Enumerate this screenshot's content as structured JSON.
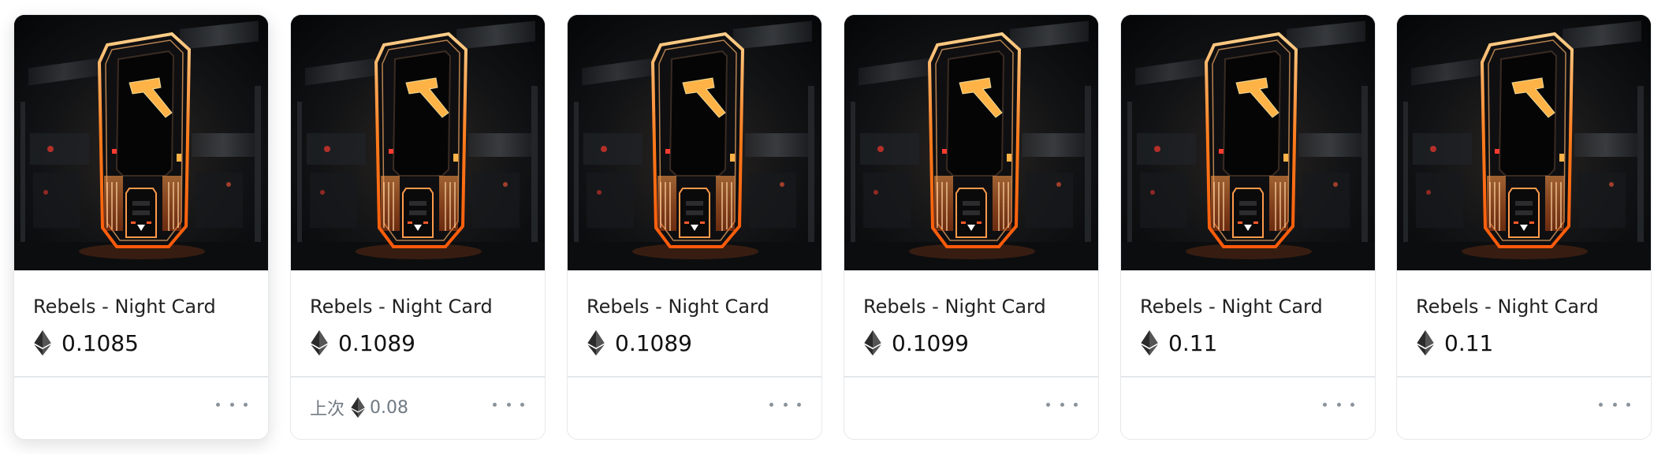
{
  "cards": [
    {
      "title": "Rebels - Night Card",
      "price": "0.1085",
      "last_label": "",
      "last_price": "",
      "currency_icon": "ethereum-icon"
    },
    {
      "title": "Rebels - Night Card",
      "price": "0.1089",
      "last_label": "上次",
      "last_price": "0.08",
      "currency_icon": "ethereum-icon"
    },
    {
      "title": "Rebels - Night Card",
      "price": "0.1089",
      "last_label": "",
      "last_price": "",
      "currency_icon": "ethereum-icon"
    },
    {
      "title": "Rebels - Night Card",
      "price": "0.1099",
      "last_label": "",
      "last_price": "",
      "currency_icon": "ethereum-icon"
    },
    {
      "title": "Rebels - Night Card",
      "price": "0.11",
      "last_label": "",
      "last_price": "",
      "currency_icon": "ethereum-icon"
    },
    {
      "title": "Rebels - Night Card",
      "price": "0.11",
      "last_label": "",
      "last_price": "",
      "currency_icon": "ethereum-icon"
    }
  ],
  "colors": {
    "card_border": "#e5e8eb",
    "glow_orange": "#ff8a2a",
    "muted_text": "#707a83"
  },
  "icons": {
    "more": "more-options-icon"
  }
}
